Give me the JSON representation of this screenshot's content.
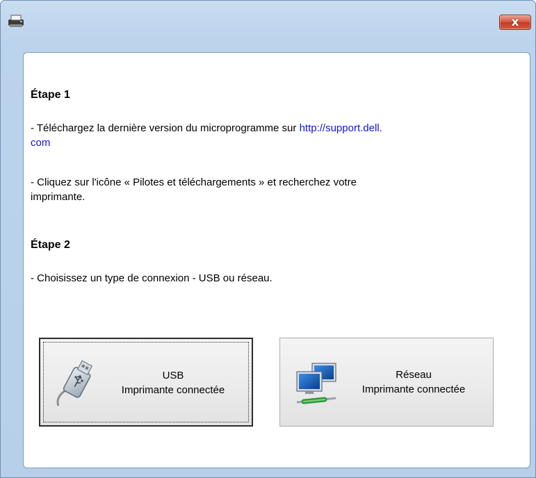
{
  "window": {
    "title": "",
    "close_label": "x"
  },
  "step1": {
    "title": "Étape 1",
    "line1_prefix": "- Téléchargez la dernière version du microprogramme sur ",
    "line1_link_part1": "http://support.dell.",
    "line1_link_part2": "com",
    "line2_part1": "- Cliquez sur l'icône « Pilotes et téléchargements » et recherchez votre",
    "line2_part2": "imprimante."
  },
  "step2": {
    "title": "Étape 2",
    "line1": "- Choisissez un type de connexion - USB ou réseau."
  },
  "buttons": {
    "usb": {
      "line1": "USB",
      "line2": "Imprimante connectée",
      "icon": "usb-drive-icon"
    },
    "network": {
      "line1": "Réseau",
      "line2": "Imprimante connectée",
      "icon": "network-computers-icon"
    }
  },
  "colors": {
    "link": "#1414dc",
    "close_button": "#c43b22",
    "frame": "#bcd3ec"
  }
}
